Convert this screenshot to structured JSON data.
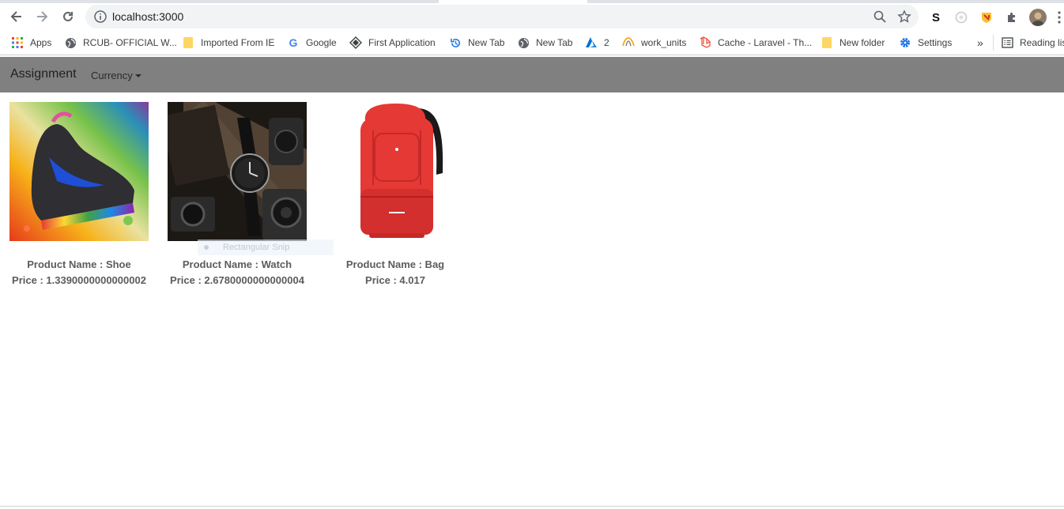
{
  "browser": {
    "url": "localhost:3000",
    "bookmarks": [
      {
        "label": "Apps",
        "icon": "apps-grid-icon"
      },
      {
        "label": "RCUB- OFFICIAL W...",
        "icon": "globe-icon"
      },
      {
        "label": "Imported From IE",
        "icon": "folder-icon"
      },
      {
        "label": "Google",
        "icon": "google-icon"
      },
      {
        "label": "First Application",
        "icon": "diamond-icon"
      },
      {
        "label": "New Tab",
        "icon": "history-icon"
      },
      {
        "label": "New Tab",
        "icon": "globe-icon"
      },
      {
        "label": "2",
        "icon": "azure-icon"
      },
      {
        "label": "work_units",
        "icon": "pma-icon"
      },
      {
        "label": "Cache - Laravel - Th...",
        "icon": "laravel-icon"
      },
      {
        "label": "New folder",
        "icon": "folder-icon"
      },
      {
        "label": "Settings",
        "icon": "gear-icon"
      }
    ],
    "overflow": "»",
    "reading_list": "Reading list",
    "extension_s": "S"
  },
  "app": {
    "brand": "Assignment",
    "currency_label": "Currency"
  },
  "products": [
    {
      "name": "Product Name : Shoe",
      "price": "Price : 1.3390000000000002",
      "image": "shoe-image"
    },
    {
      "name": "Product Name : Watch",
      "price": "Price : 2.6780000000000004",
      "image": "watch-image"
    },
    {
      "name": "Product Name : Bag",
      "price": "Price : 4.017",
      "image": "bag-image"
    }
  ],
  "overlay": {
    "snip_label": "Rectangular Snip"
  },
  "colors": {
    "navbar": "#808080",
    "text": "#5c5c5c",
    "bag_red": "#e53935"
  }
}
